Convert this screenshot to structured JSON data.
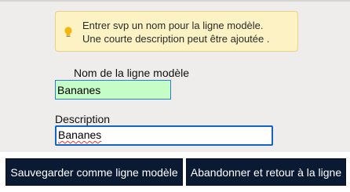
{
  "info": {
    "icon": "lightbulb-icon",
    "line1": "Entrer svp un nom pour la ligne modèle.",
    "line2": "Une courte description peut être ajoutée ."
  },
  "form": {
    "name_label": "Nom de la ligne modèle",
    "name_value": "Bananes",
    "description_label": "Description",
    "description_value": "Bananes"
  },
  "buttons": {
    "save_label": "Sauvegarder comme ligne modèle",
    "cancel_label": "Abandonner et retour à la ligne"
  },
  "colors": {
    "info_background": "#fdf2c4",
    "name_field_background": "#c6fcc6",
    "focus_border": "#1565c0",
    "button_background": "#0b1a33"
  }
}
